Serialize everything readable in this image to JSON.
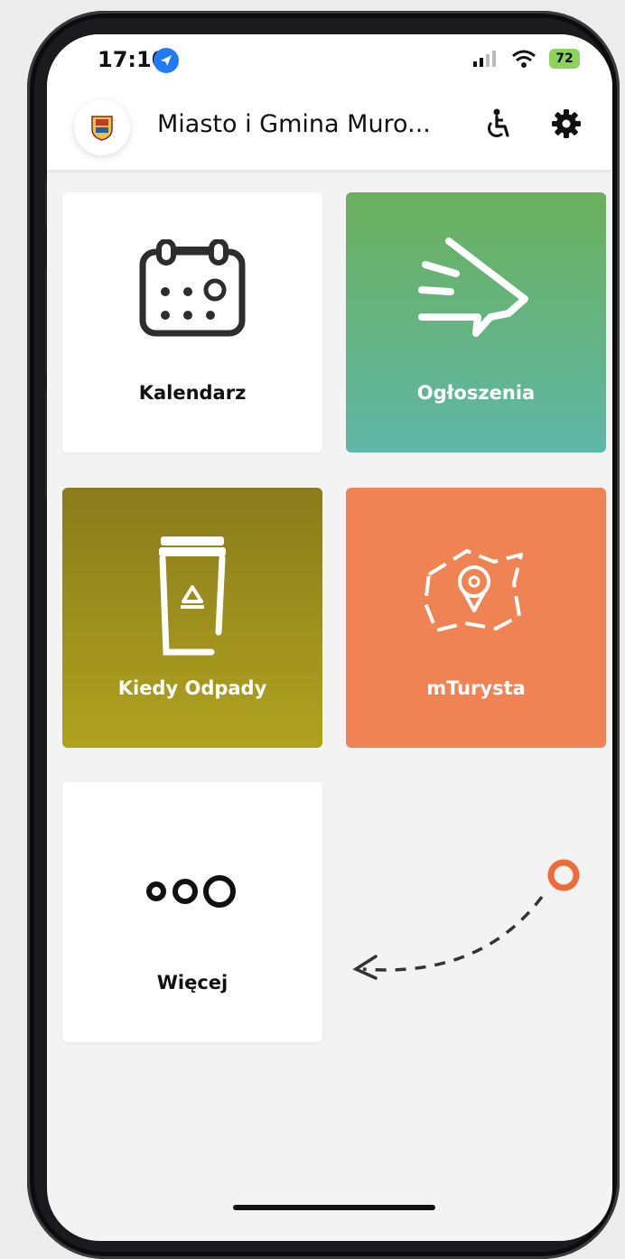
{
  "status_bar": {
    "time": "17:10",
    "battery": "72"
  },
  "header": {
    "title": "Miasto i Gmina Muro..."
  },
  "tiles": [
    {
      "label": "Kalendarz",
      "icon": "calendar-icon",
      "bg": "#ffffff",
      "fg": "#111111"
    },
    {
      "label": "Ogłoszenia",
      "icon": "megaphone-icon",
      "bg": "linear-gradient(#6bb05c,#5fb7a7)",
      "fg": "#ffffff"
    },
    {
      "label": "Kiedy Odpady",
      "icon": "recycle-bin-icon",
      "bg": "linear-gradient(#8a7c1c,#b0a21e)",
      "fg": "#ffffff"
    },
    {
      "label": "mTurysta",
      "icon": "map-pin-icon",
      "bg": "#ef8354",
      "fg": "#ffffff"
    },
    {
      "label": "Więcej",
      "icon": "more-dots-icon",
      "bg": "#ffffff",
      "fg": "#111111"
    }
  ],
  "colors": {
    "accent_orange": "#ef6b3a"
  }
}
